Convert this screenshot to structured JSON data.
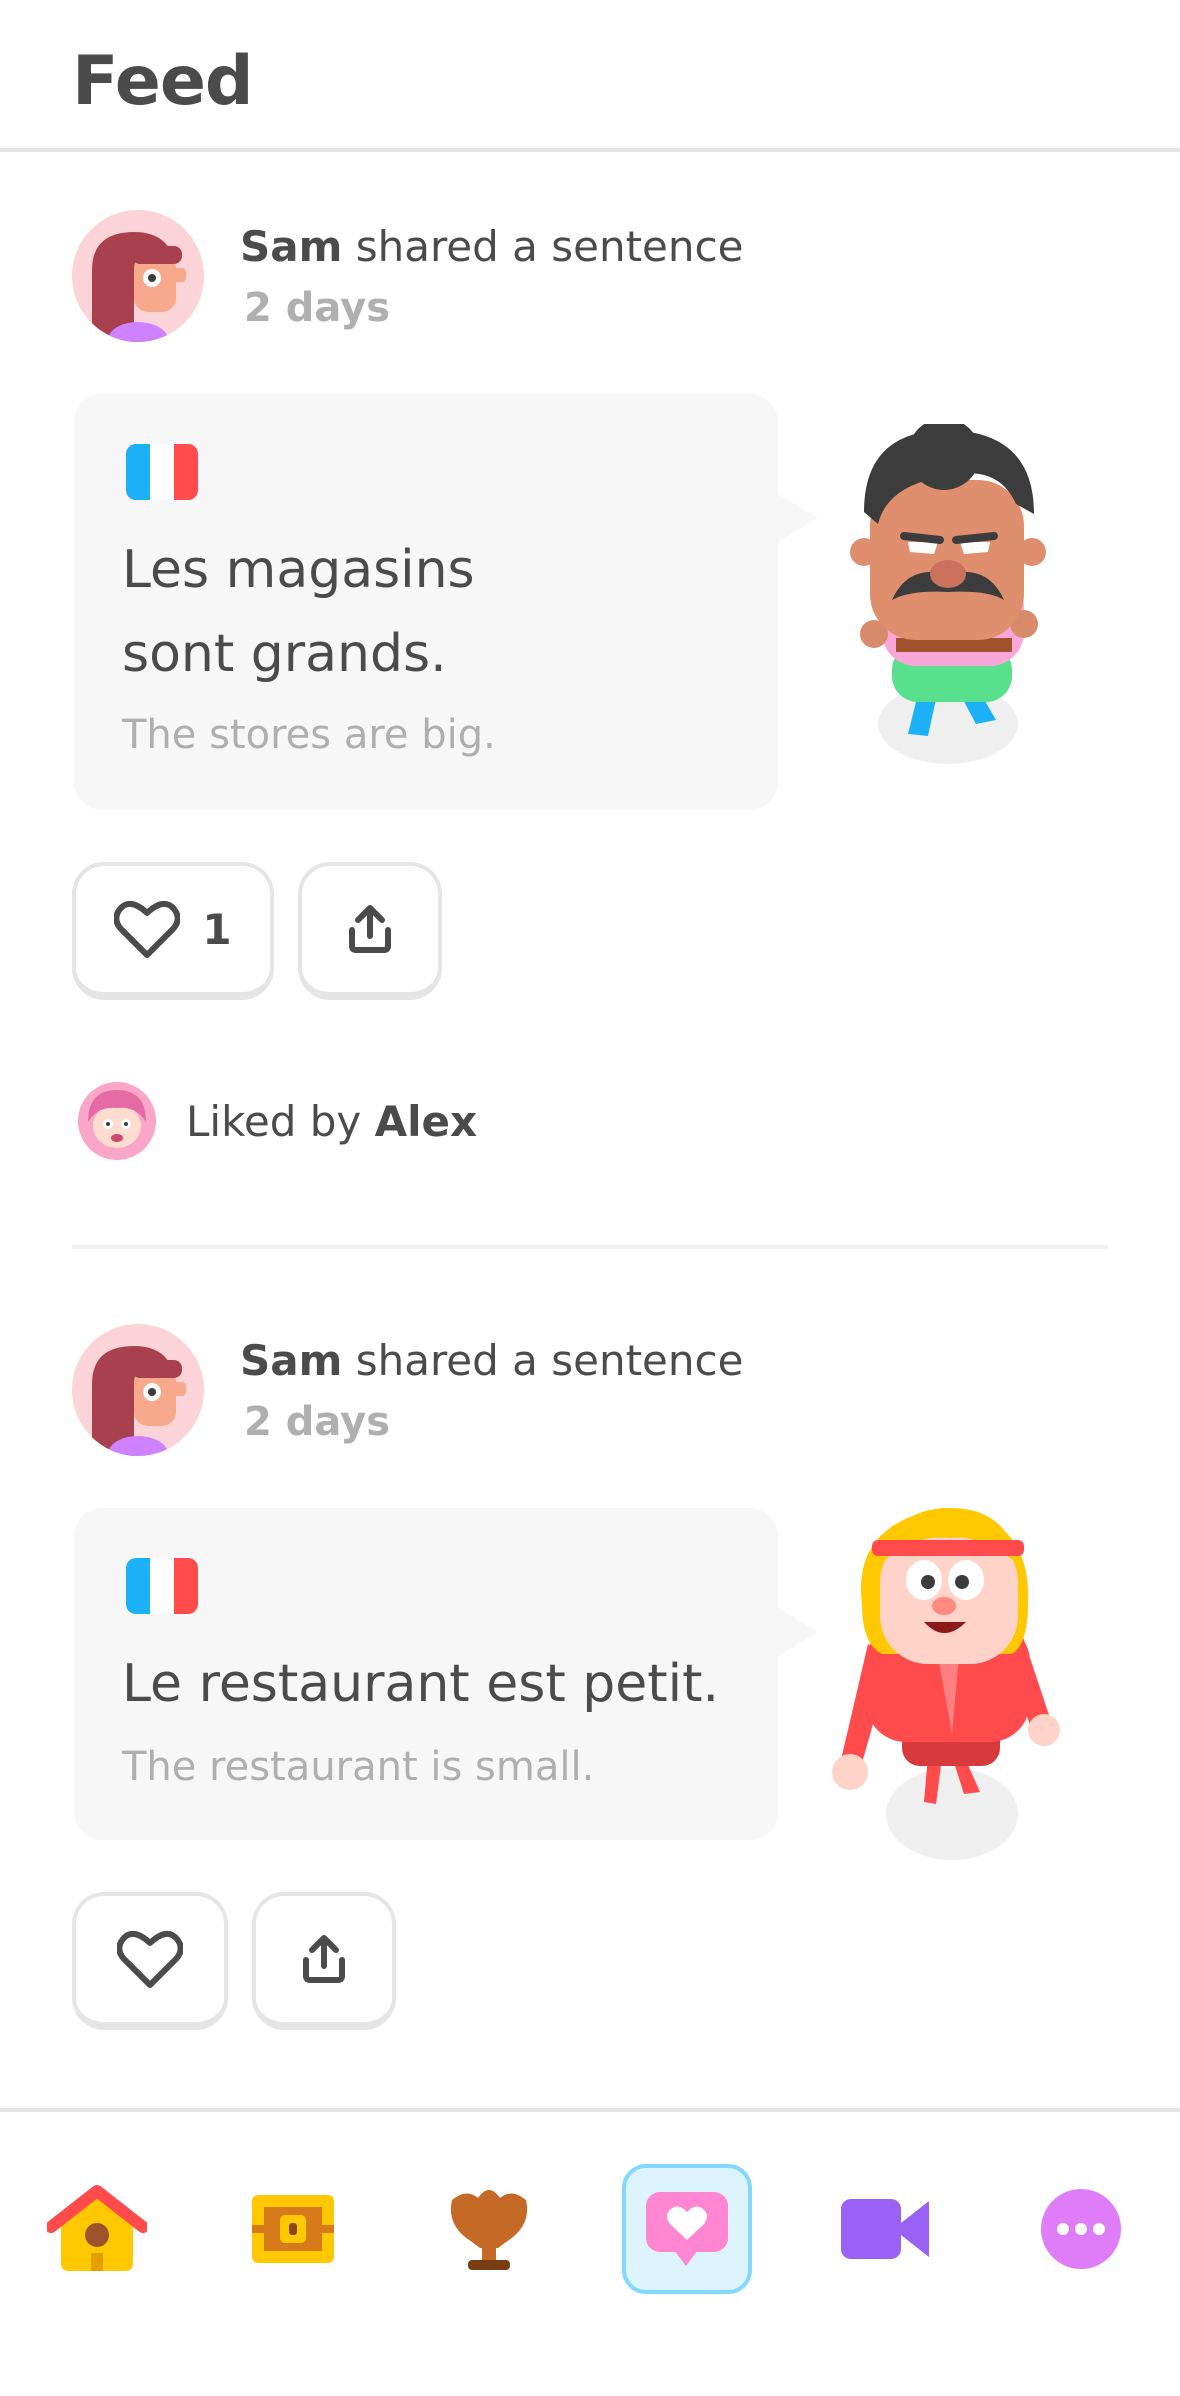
{
  "header": {
    "title": "Feed"
  },
  "posts": [
    {
      "author": "Sam",
      "action": "shared a sentence",
      "time": "2 days",
      "sentence_line1": "Les magasins",
      "sentence_line2": "sont grands.",
      "translation": "The stores are big.",
      "likes": "1",
      "character": "mustache-character"
    },
    {
      "author": "Sam",
      "action": "shared a sentence",
      "time": "2 days",
      "sentence_line1": "Le restaurant est petit.",
      "translation": "The restaurant is small.",
      "character": "headband-character"
    }
  ],
  "liked": {
    "prefix": "Liked by",
    "name": "Alex"
  },
  "colors": {
    "flag_blue": "#1cb0f6",
    "flag_red": "#ff4b4b",
    "active_tab_bg": "#ddf4ff",
    "active_tab_border": "#84d8ff"
  },
  "tabs": [
    {
      "icon": "home-icon",
      "active": false
    },
    {
      "icon": "chest-icon",
      "active": false
    },
    {
      "icon": "trophy-icon",
      "active": false
    },
    {
      "icon": "feed-heart-icon",
      "active": true
    },
    {
      "icon": "video-icon",
      "active": false
    },
    {
      "icon": "more-icon",
      "active": false
    }
  ]
}
